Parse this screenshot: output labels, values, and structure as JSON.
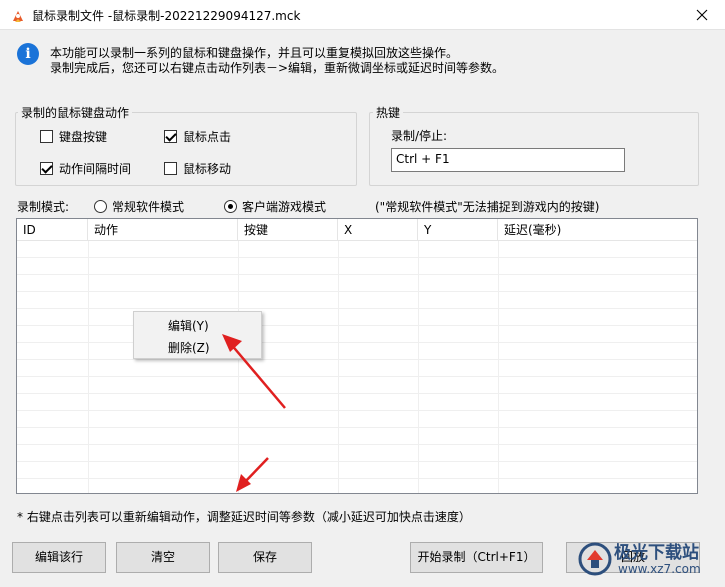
{
  "window": {
    "title": "鼠标录制文件 -鼠标录制-20221229094127.mck"
  },
  "info": {
    "line1": "本功能可以录制一系列的鼠标和键盘操作，并且可以重复模拟回放这些操作。",
    "line2": "录制完成后，您还可以右键点击动作列表－>编辑，重新微调坐标或延迟时间等参数。"
  },
  "record_actions": {
    "label": "录制的鼠标键盘动作",
    "options": [
      {
        "label": "键盘按键",
        "checked": false
      },
      {
        "label": "鼠标点击",
        "checked": true
      },
      {
        "label": "动作间隔时间",
        "checked": true
      },
      {
        "label": "鼠标移动",
        "checked": false
      }
    ]
  },
  "hotkey": {
    "label": "热键",
    "field_label": "录制/停止:",
    "value": "Ctrl + F1"
  },
  "mode": {
    "label": "录制模式:",
    "options": [
      {
        "label": "常规软件模式",
        "selected": false
      },
      {
        "label": "客户端游戏模式",
        "selected": true
      }
    ],
    "note": "(\"常规软件模式\"无法捕捉到游戏内的按键)"
  },
  "list": {
    "columns": [
      "ID",
      "动作",
      "按键",
      "X",
      "Y",
      "延迟(毫秒)"
    ]
  },
  "context_menu": {
    "items": [
      "编辑(Y)",
      "删除(Z)"
    ]
  },
  "footnote": "* 右键点击列表可以重新编辑动作，调整延迟时间等参数（减小延迟可加快点击速度）",
  "buttons": {
    "edit_row": "编辑该行",
    "clear": "清空",
    "save": "保存",
    "start_record": "开始录制（Ctrl+F1）",
    "playback": "回放"
  },
  "watermark": {
    "line1": "极光下载站",
    "line2": "www.xz7.com"
  },
  "colors": {
    "info_icon": "#1a73d8",
    "arrow": "#e02020",
    "watermark": "#2d4f7d"
  }
}
